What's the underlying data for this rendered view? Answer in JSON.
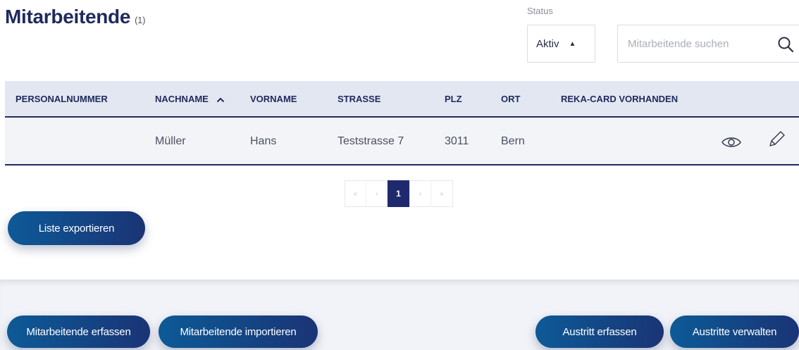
{
  "header": {
    "title": "Mitarbeitende",
    "count": "(1)"
  },
  "filters": {
    "status_label": "Status",
    "status_value": "Aktiv",
    "search_placeholder": "Mitarbeitende suchen",
    "search_value": ""
  },
  "table": {
    "columns": [
      "PERSONALNUMMER",
      "NACHNAME",
      "VORNAME",
      "STRASSE",
      "PLZ",
      "ORT",
      "REKA-CARD VORHANDEN"
    ],
    "sort_column": "NACHNAME",
    "sort_direction": "ascending",
    "rows": [
      {
        "personalnummer": "",
        "nachname": "Müller",
        "vorname": "Hans",
        "strasse": "Teststrasse 7",
        "plz": "3011",
        "ort": "Bern",
        "reka_card": ""
      }
    ]
  },
  "pagination": {
    "first": "«",
    "prev": "‹",
    "current": "1",
    "next": "›",
    "last": "»"
  },
  "actions": {
    "export": "Liste exportieren",
    "create": "Mitarbeitende erfassen",
    "import": "Mitarbeitende importieren",
    "exit_create": "Austritt erfassen",
    "exit_manage": "Austritte verwalten"
  },
  "icons": {
    "search": "search-icon",
    "view": "eye-icon",
    "edit": "pencil-icon",
    "sort": "chevron-up-icon"
  },
  "colors": {
    "primary": "#1f2a5c",
    "button_gradient_start": "#0d5a97",
    "button_gradient_end": "#1a3475",
    "header_bg": "#e3e7f2",
    "row_bg": "#f3f4f7"
  }
}
